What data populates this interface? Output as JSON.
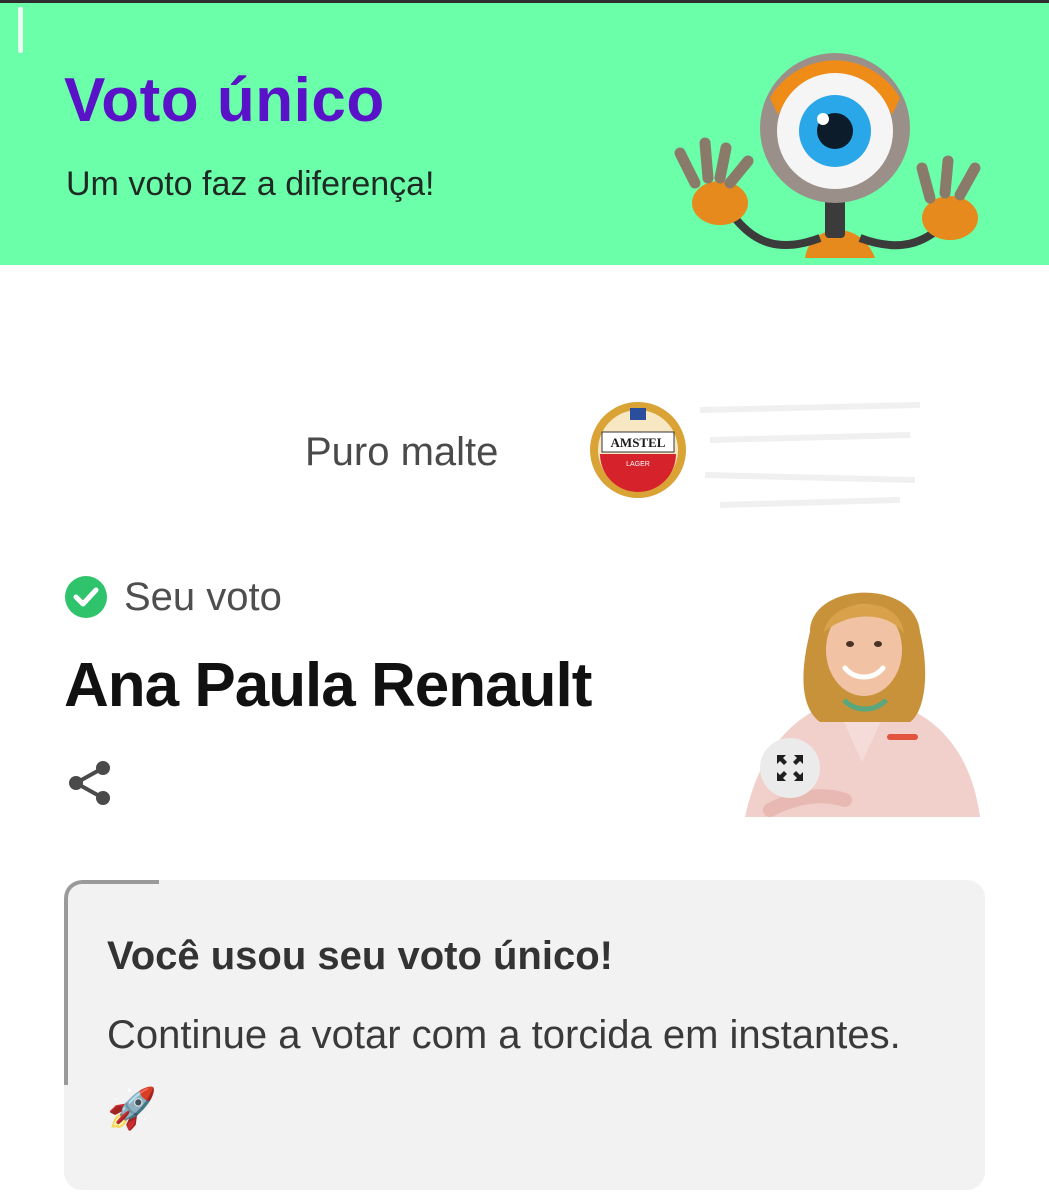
{
  "header": {
    "title": "Voto único",
    "subtitle": "Um voto faz a diferença!",
    "background_color": "#6cffa9",
    "title_color": "#5a12c8",
    "mascot_icon": "big-brother-eye-mascot"
  },
  "sponsor": {
    "text": "Puro malte",
    "logo_text": "AMSTEL",
    "logo_subtext": "LAGER"
  },
  "vote": {
    "status_label": "Seu voto",
    "status_icon": "check-circle-icon",
    "status_color": "#2fc36b",
    "candidate_name": "Ana Paula Renault",
    "share_icon": "share-icon",
    "expand_icon": "expand-icon"
  },
  "notice": {
    "title": "Você usou seu voto único!",
    "body": "Continue a votar com a torcida em instantes.",
    "emoji": "🚀"
  }
}
